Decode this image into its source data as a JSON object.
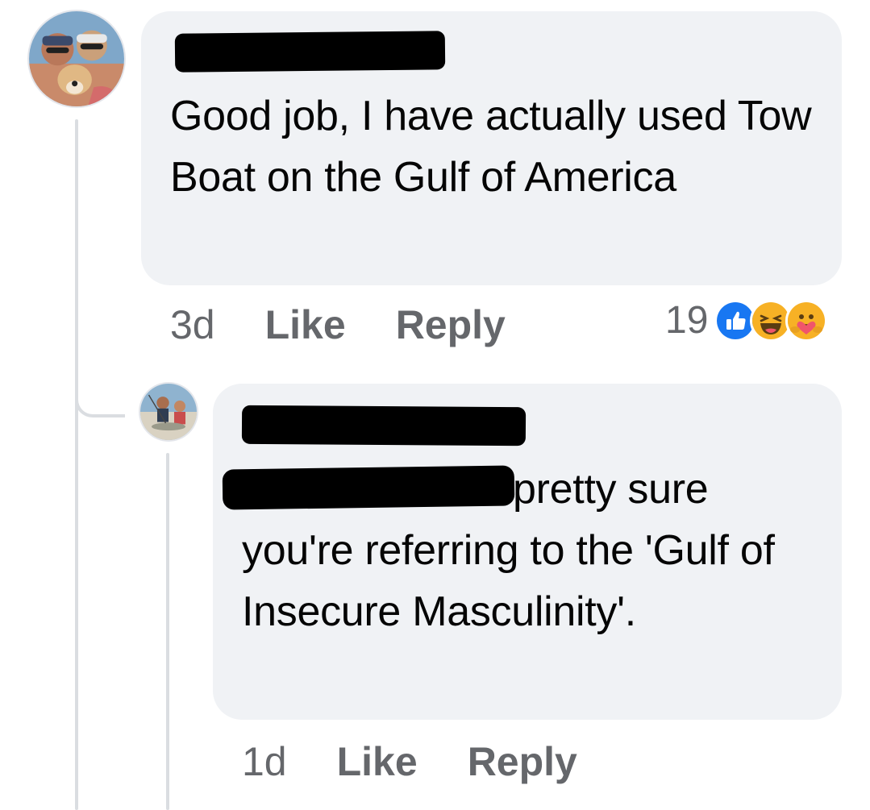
{
  "comment": {
    "author": "",
    "text": "Good job, I have actually used Tow Boat on the Gulf of America",
    "time": "3d",
    "like_label": "Like",
    "reply_label": "Reply",
    "reaction_count": "19",
    "reactions": [
      "like-icon",
      "haha-icon",
      "care-icon"
    ]
  },
  "reply": {
    "author": "",
    "mention": "",
    "text": "pretty sure you're referring to the 'Gulf of Insecure Masculinity'.",
    "time": "1d",
    "like_label": "Like",
    "reply_label": "Reply"
  },
  "colors": {
    "bubble": "#f0f2f5",
    "action_text": "#65676b",
    "thread_line": "#dadde1",
    "like_blue": "#1877f2",
    "reaction_yellow": "#f7b125"
  }
}
